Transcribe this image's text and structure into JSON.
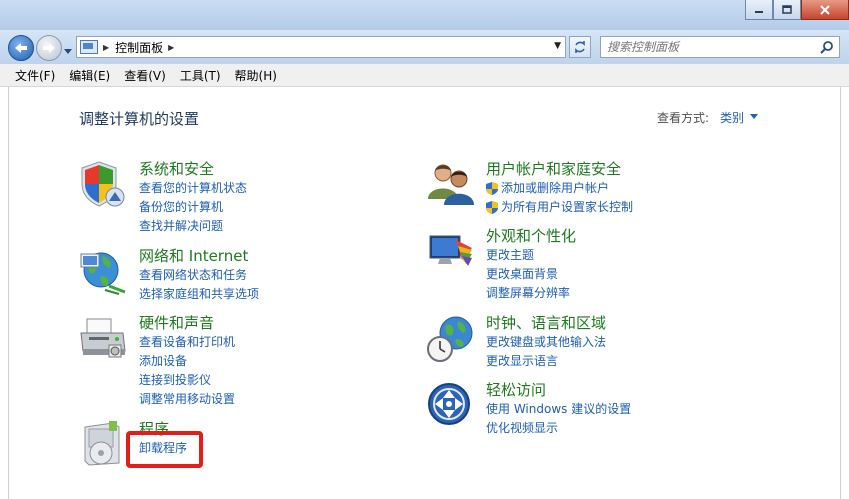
{
  "address": {
    "path": "控制面板",
    "search_placeholder": "搜索控制面板"
  },
  "menu": [
    "文件(F)",
    "编辑(E)",
    "查看(V)",
    "工具(T)",
    "帮助(H)"
  ],
  "page": {
    "title": "调整计算机的设置",
    "view_by_label": "查看方式:",
    "view_by_value": "类别"
  },
  "categories": [
    {
      "heading": "系统和安全",
      "icon": "shield-icon",
      "links": [
        "查看您的计算机状态",
        "备份您的计算机",
        "查找并解决问题"
      ]
    },
    {
      "heading": "网络和 Internet",
      "icon": "network-globe-icon",
      "links": [
        "查看网络状态和任务",
        "选择家庭组和共享选项"
      ]
    },
    {
      "heading": "硬件和声音",
      "icon": "printer-icon",
      "links": [
        "查看设备和打印机",
        "添加设备",
        "连接到投影仪",
        "调整常用移动设置"
      ]
    },
    {
      "heading": "程序",
      "icon": "programs-icon",
      "links": [
        "卸载程序"
      ]
    },
    {
      "heading": "用户帐户和家庭安全",
      "icon": "users-icon",
      "links": [
        "添加或删除用户帐户",
        "为所有用户设置家长控制"
      ]
    },
    {
      "heading": "外观和个性化",
      "icon": "display-palette-icon",
      "links": [
        "更改主题",
        "更改桌面背景",
        "调整屏幕分辨率"
      ]
    },
    {
      "heading": "时钟、语言和区域",
      "icon": "clock-globe-icon",
      "links": [
        "更改键盘或其他输入法",
        "更改显示语言"
      ]
    },
    {
      "heading": "轻松访问",
      "icon": "ease-of-access-icon",
      "links": [
        "使用 Windows 建议的设置",
        "优化视频显示"
      ]
    }
  ],
  "colors": {
    "heading_green": "#1e7a1e",
    "link_blue": "#1e5eb5",
    "highlight_red": "#e41c1c"
  }
}
